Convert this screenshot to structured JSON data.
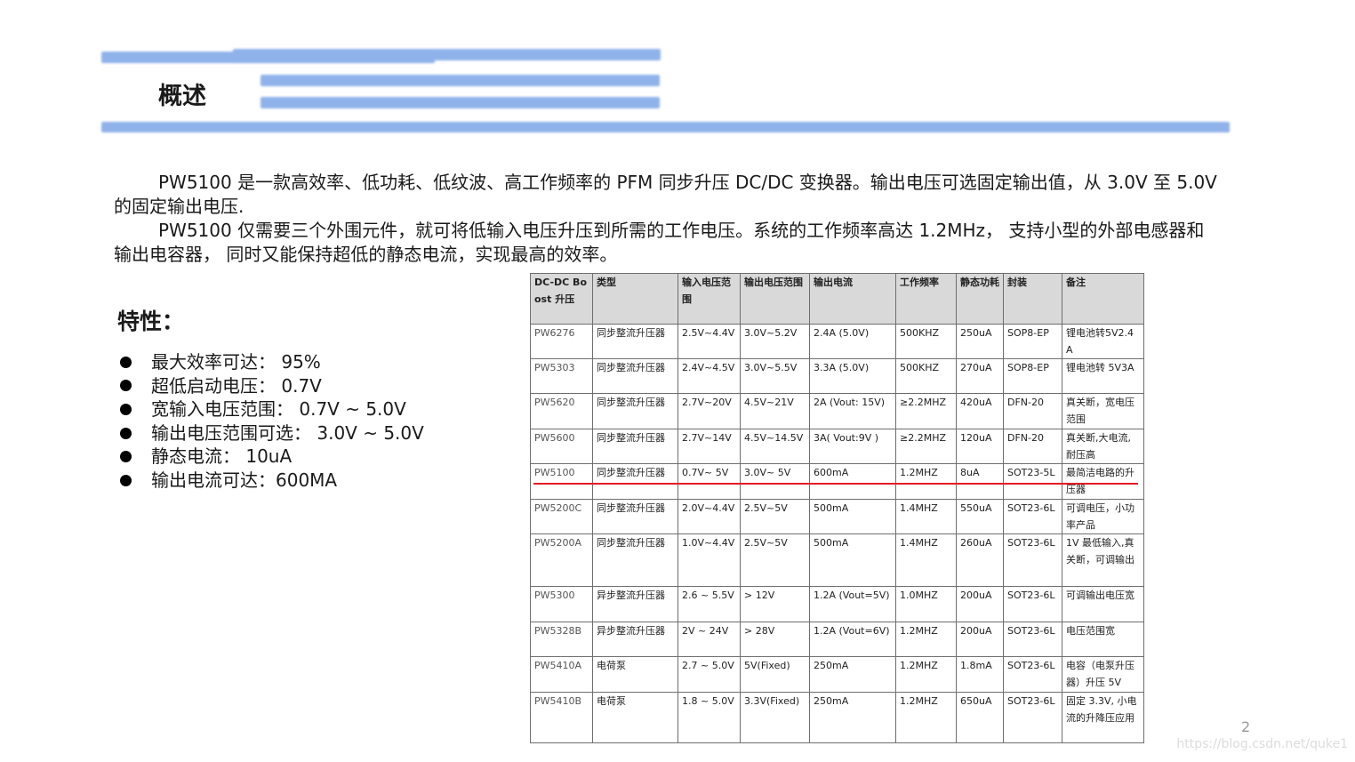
{
  "title": "概述",
  "intro": [
    "PW5100 是一款高效率、低功耗、低纹波、高工作频率的 PFM 同步升压 DC/DC 变换器。输出电压可选固定输出值，从 3.0V 至 5.0V 的固定输出电压.",
    "PW5100 仅需要三个外围元件，就可将低输入电压升压到所需的工作电压。系统的工作频率高达 1.2MHz， 支持小型的外部电感器和输出电容器， 同时又能保持超低的静态电流，实现最高的效率。"
  ],
  "features": {
    "heading": "特性：",
    "items": [
      "最大效率可达： 95%",
      "超低启动电压： 0.7V",
      "宽输入电压范围： 0.7V ~ 5.0V",
      "输出电压范围可选： 3.0V ~ 5.0V",
      "静态电流： 10uA",
      "输出电流可达：600MA"
    ]
  },
  "table": {
    "headers": [
      "DC-DC Boost 升压",
      "类型",
      "输入电压范围",
      "输出电压范围",
      "输出电流",
      "工作频率",
      "静态功耗",
      "封装",
      "备注"
    ],
    "rows": [
      [
        "PW6276",
        "同步整流升压器",
        "2.5V~4.4V",
        "3.0V~5.2V",
        "2.4A (5.0V)",
        "500KHZ",
        "250uA",
        "SOP8-EP",
        "锂电池转5V2.4A"
      ],
      [
        "PW5303",
        "同步整流升压器",
        "2.4V~4.5V",
        "3.0V~5.5V",
        "3.3A (5.0V)",
        "500KHZ",
        "270uA",
        "SOP8-EP",
        "锂电池转 5V3A"
      ],
      [
        "PW5620",
        "同步整流升压器",
        "2.7V~20V",
        "4.5V~21V",
        "2A (Vout: 15V)",
        "≥2.2MHZ",
        "420uA",
        "DFN-20",
        "真关断，宽电压范围"
      ],
      [
        "PW5600",
        "同步整流升压器",
        "2.7V~14V",
        "4.5V~14.5V",
        "3A( Vout:9V )",
        "≥2.2MHZ",
        "120uA",
        "DFN-20",
        "真关断,大电流,耐压高"
      ],
      [
        "PW5100",
        "同步整流升压器",
        "0.7V~ 5V",
        "3.0V~ 5V",
        "600mA",
        "1.2MHZ",
        "8uA",
        "SOT23-5L",
        "最简洁电路的升压器"
      ],
      [
        "PW5200C",
        "同步整流升压器",
        "2.0V~4.4V",
        "2.5V~5V",
        "500mA",
        "1.4MHZ",
        "550uA",
        "SOT23-6L",
        "可调电压，小功率产品"
      ],
      [
        "PW5200A",
        "同步整流升压器",
        "1.0V~4.4V",
        "2.5V~5V",
        "500mA",
        "1.4MHZ",
        "260uA",
        "SOT23-6L",
        "1V 最低输入,真关断，可调输出"
      ],
      [
        "PW5300",
        "异步整流升压器",
        "2.6 ~ 5.5V",
        "> 12V",
        "1.2A (Vout=5V)",
        "1.0MHZ",
        "200uA",
        "SOT23-6L",
        "可调输出电压宽"
      ],
      [
        "PW5328B",
        "异步整流升压器",
        "2V ~ 24V",
        "> 28V",
        "1.2A (Vout=6V)",
        "1.2MHZ",
        "200uA",
        "SOT23-6L",
        "电压范围宽"
      ],
      [
        "PW5410A",
        "电荷泵",
        "2.7 ~ 5.0V",
        "5V(Fixed)",
        "250mA",
        "1.2MHZ",
        "1.8mA",
        "SOT23-6L",
        "电容（电泵升压器）升压 5V"
      ],
      [
        "PW5410B",
        "电荷泵",
        "1.8 ~ 5.0V",
        "3.3V(Fixed)",
        "250mA",
        "1.2MHZ",
        "650uA",
        "SOT23-6L",
        "固定 3.3V, 小电流的升降压应用"
      ]
    ]
  },
  "page_number": "2",
  "watermark": "https://blog.csdn.net/quke1",
  "colors": {
    "accent_bar": "#8fb2ea",
    "highlight_line": "#e31c23"
  }
}
